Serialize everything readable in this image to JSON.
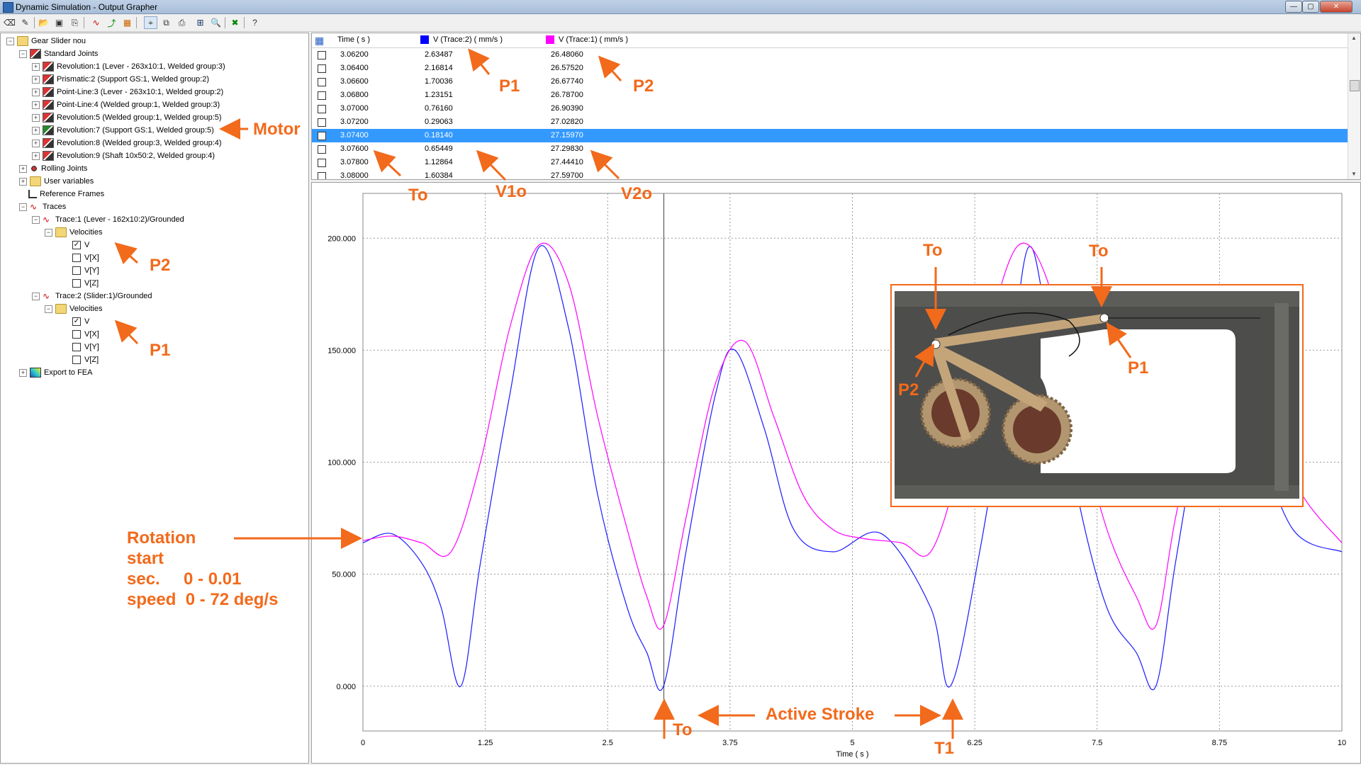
{
  "window": {
    "title": "Dynamic Simulation - Output Grapher",
    "buttons": {
      "minimize": "—",
      "maximize": "▢",
      "close": "✕"
    }
  },
  "toolbar": {
    "icons": [
      "erase-icon",
      "pencil-icon",
      "open-icon",
      "save-icon",
      "save-as-icon",
      "curve-icon",
      "add-curve-icon",
      "chart-icon",
      "cursor-icon",
      "copy-icon",
      "print-icon",
      "zoom-fit-icon",
      "zoom-icon",
      "excel-icon",
      "help-icon"
    ]
  },
  "tree": {
    "root": "Gear Slider nou",
    "standard_joints": "Standard Joints",
    "joints": [
      "Revolution:1 (Lever - 263x10:1, Welded group:3)",
      "Prismatic:2 (Support GS:1, Welded group:2)",
      "Point-Line:3 (Lever - 263x10:1, Welded group:2)",
      "Point-Line:4 (Welded group:1, Welded group:3)",
      "Revolution:5 (Welded group:1, Welded group:5)",
      "Revolution:7 (Support GS:1, Welded group:5)",
      "Revolution:8 (Welded group:3, Welded group:4)",
      "Revolution:9 (Shaft 10x50:2, Welded group:4)"
    ],
    "rolling_joints": "Rolling Joints",
    "user_variables": "User variables",
    "reference_frames": "Reference Frames",
    "traces": "Traces",
    "trace1": "Trace:1 (Lever - 162x10:2)/Grounded",
    "trace2": "Trace:2 (Slider:1)/Grounded",
    "velocities": "Velocities",
    "components": [
      {
        "label": "V",
        "checked": true
      },
      {
        "label": "V[X]",
        "checked": false
      },
      {
        "label": "V[Y]",
        "checked": false
      },
      {
        "label": "V[Z]",
        "checked": false
      }
    ],
    "export": "Export to FEA"
  },
  "table": {
    "headers": {
      "time": "Time ( s )",
      "col1": "V (Trace:2) ( mm/s )",
      "col2": "V (Trace:1) ( mm/s )"
    },
    "col1_color": "#0000ff",
    "col2_color": "#ff00ff",
    "rows": [
      [
        "3.06200",
        "2.63487",
        "26.48060"
      ],
      [
        "3.06400",
        "2.16814",
        "26.57520"
      ],
      [
        "3.06600",
        "1.70036",
        "26.67740"
      ],
      [
        "3.06800",
        "1.23151",
        "26.78700"
      ],
      [
        "3.07000",
        "0.76160",
        "26.90390"
      ],
      [
        "3.07200",
        "0.29063",
        "27.02820"
      ],
      [
        "3.07400",
        "0.18140",
        "27.15970"
      ],
      [
        "3.07600",
        "0.65449",
        "27.29830"
      ],
      [
        "3.07800",
        "1.12864",
        "27.44410"
      ],
      [
        "3.08000",
        "1.60384",
        "27.59700"
      ]
    ],
    "selected_row": 6
  },
  "chart_data": {
    "type": "line",
    "xlabel": "Time ( s )",
    "xlim": [
      0,
      10
    ],
    "ylim": [
      -20,
      220
    ],
    "x_ticks": [
      "0",
      "1.25",
      "2.5",
      "3.75",
      "5",
      "6.25",
      "7.5",
      "8.75",
      "10"
    ],
    "y_ticks": [
      "0.000",
      "50.000",
      "100.000",
      "150.000",
      "200.000"
    ],
    "grid": true,
    "cursor_x": 3.074,
    "series": [
      {
        "color": "#1a1aff",
        "x": [
          0,
          0.3,
          0.6,
          0.8,
          1.0,
          1.2,
          1.5,
          1.8,
          2.1,
          2.4,
          2.7,
          2.9,
          3.07,
          3.3,
          3.6,
          3.8,
          4.1,
          4.4,
          4.8,
          5.3,
          5.8,
          6.0,
          6.3,
          6.6,
          6.8,
          7.0,
          7.3,
          7.6,
          7.9,
          8.1,
          8.3,
          8.6,
          8.8,
          9.1,
          9.5,
          10
        ],
        "y": [
          64,
          68,
          55,
          35,
          0,
          55,
          130,
          196,
          160,
          85,
          35,
          15,
          0,
          60,
          130,
          150,
          115,
          70,
          60,
          68,
          35,
          0,
          60,
          140,
          196,
          160,
          85,
          35,
          15,
          0,
          55,
          130,
          150,
          115,
          70,
          60
        ]
      },
      {
        "color": "#ff00ff",
        "x": [
          0,
          0.3,
          0.6,
          0.9,
          1.2,
          1.5,
          1.8,
          2.1,
          2.4,
          2.7,
          2.9,
          3.07,
          3.3,
          3.6,
          3.9,
          4.2,
          4.5,
          4.8,
          5.1,
          5.5,
          5.8,
          6.1,
          6.4,
          6.7,
          7.0,
          7.3,
          7.6,
          7.9,
          8.1,
          8.3,
          8.6,
          8.9,
          9.2,
          9.6,
          10
        ],
        "y": [
          65,
          67,
          64,
          60,
          100,
          160,
          197,
          180,
          120,
          70,
          40,
          27,
          75,
          135,
          154,
          120,
          85,
          70,
          66,
          64,
          60,
          100,
          160,
          197,
          180,
          120,
          70,
          40,
          27,
          75,
          135,
          154,
          120,
          85,
          64
        ]
      }
    ]
  },
  "annotations": {
    "motor": "Motor",
    "p1_table": "P1",
    "p2_table": "P2",
    "to_table": "To",
    "v1o": "V1o",
    "v2o": "V2o",
    "p2_tree": "P2",
    "p1_tree": "P1",
    "rotation_lines": [
      "Rotation",
      "start",
      "sec.     0 - 0.01",
      "speed  0 - 72 deg/s"
    ],
    "to_bottom": "To",
    "active_stroke": "Active Stroke",
    "t1": "T1",
    "inset_to_left": "To",
    "inset_to_right": "To",
    "inset_p1": "P1",
    "inset_p2": "P2",
    "accent": "#f26a1b"
  }
}
